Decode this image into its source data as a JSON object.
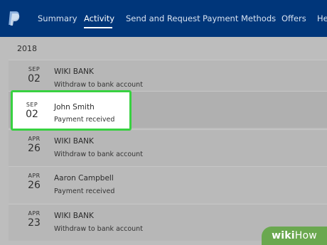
{
  "nav": {
    "items": [
      {
        "label": "Summary"
      },
      {
        "label": "Activity"
      },
      {
        "label": "Send and Request"
      },
      {
        "label": "Payment Methods"
      },
      {
        "label": "Offers"
      },
      {
        "label": "He"
      }
    ],
    "active": "Activity",
    "logo_icon": "paypal-logo-icon"
  },
  "activity": {
    "year": "2018",
    "rows": [
      {
        "month": "SEP",
        "day": "02",
        "name": "WIKI BANK",
        "description": "Withdraw to bank account"
      },
      {
        "month": "SEP",
        "day": "02",
        "name": "John Smith",
        "description": "Payment received"
      },
      {
        "month": "APR",
        "day": "26",
        "name": "WIKI BANK",
        "description": "Withdraw to bank account"
      },
      {
        "month": "APR",
        "day": "26",
        "name": "Aaron Campbell",
        "description": "Payment received"
      },
      {
        "month": "APR",
        "day": "23",
        "name": "WIKI BANK",
        "description": "Withdraw to bank account"
      }
    ]
  },
  "watermark": {
    "part1": "wiki",
    "part2": "How"
  },
  "colors": {
    "nav_bg": "#00367a",
    "highlight_border": "#38d141",
    "watermark_bg": "#6aa84f"
  }
}
